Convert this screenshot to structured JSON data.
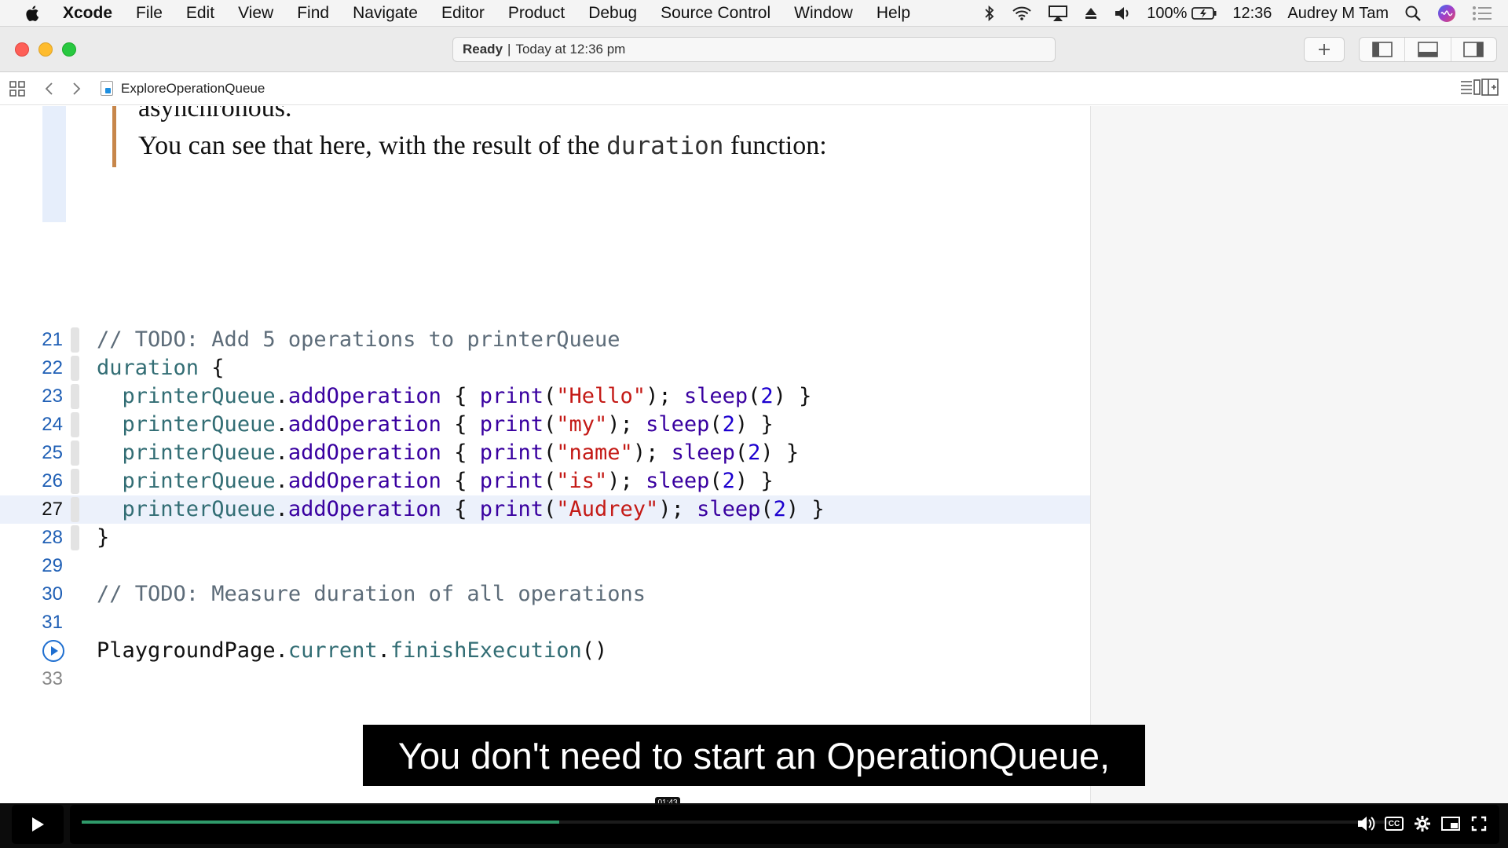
{
  "menubar": {
    "app_name": "Xcode",
    "items": [
      "File",
      "Edit",
      "View",
      "Find",
      "Navigate",
      "Editor",
      "Product",
      "Debug",
      "Source Control",
      "Window",
      "Help"
    ],
    "battery": "100%",
    "clock": "12:36",
    "user": "Audrey M Tam"
  },
  "toolbar": {
    "status_ready": "Ready",
    "status_time": "Today at 12:36 pm"
  },
  "jumpbar": {
    "filename": "ExploreOperationQueue"
  },
  "prose": {
    "cut_text": "asynchronous.",
    "text_before": "You can see that here, with the result of the ",
    "code_word": "duration",
    "text_after": " function:"
  },
  "code": {
    "l21_num": "21",
    "l21": "// TODO: Add 5 operations to printerQueue",
    "l22_num": "22",
    "l22_a": "duration",
    "l22_b": " {",
    "l23_num": "23",
    "l24_num": "24",
    "l25_num": "25",
    "l26_num": "26",
    "l27_num": "27",
    "queue": "printerQueue",
    "dot": ".",
    "add_op": "addOperation",
    "brace_open": " { ",
    "print": "print",
    "paren_open": "(",
    "paren_close_semi": "); ",
    "sleep": "sleep",
    "sleep_arg_open": "(",
    "sleep_num": "2",
    "sleep_close": ") }",
    "s23": "\"Hello\"",
    "s24": "\"my\"",
    "s25": "\"name\"",
    "s26": "\"is\"",
    "s27": "\"Audrey\"",
    "l28_num": "28",
    "l28": "}",
    "l29_num": "29",
    "l30_num": "30",
    "l30": "// TODO: Measure duration of all operations",
    "l31_num": "31",
    "l32_a": "PlaygroundPage",
    "l32_b": ".",
    "l32_c": "current",
    "l32_d": ".",
    "l32_e": "finishExecution",
    "l32_f": "()",
    "l33_num": "33"
  },
  "video": {
    "subtitle": "You don't need to start an OperationQueue,",
    "time": "01:43",
    "progress_fraction": 0.365,
    "accent_color": "#2f9a6a"
  }
}
